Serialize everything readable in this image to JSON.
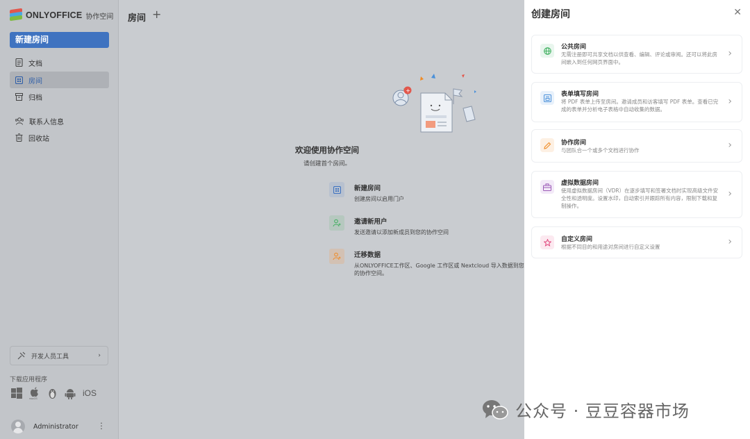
{
  "sidebar": {
    "logo_text": "ONLYOFFICE",
    "logo_sub": "协作空间",
    "new_room_button": "新建房间",
    "nav": [
      {
        "label": "文档",
        "icon": "document-icon"
      },
      {
        "label": "房间",
        "icon": "rooms-icon",
        "active": true
      },
      {
        "label": "归档",
        "icon": "archive-icon"
      },
      {
        "label": "联系人信息",
        "icon": "contacts-icon"
      },
      {
        "label": "回收站",
        "icon": "trash-icon"
      }
    ],
    "dev_tools": "开发人员工具",
    "download_label": "下载应用程序",
    "download_ios": "iOS",
    "user_name": "Administrator"
  },
  "main": {
    "title": "房间",
    "welcome_title": "欢迎使用协作空间",
    "welcome_sub": "请创建首个房间。",
    "actions": [
      {
        "title": "新建房间",
        "desc": "创建房间以启用门户"
      },
      {
        "title": "邀请新用户",
        "desc": "发送邀请以添加新成员到您的协作空间"
      },
      {
        "title": "迁移数据",
        "desc": "从ONLYOFFICE工作区、Google 工作区或 Nextcloud 导入数据到您的协作空间。"
      }
    ]
  },
  "panel": {
    "title": "创建房间",
    "cards": [
      {
        "title": "公共房间",
        "desc": "无需注册即可共享文档以供查看、编辑、评论或审阅。还可以将此房间嵌入到任何网页界面中。",
        "icon": "globe-icon",
        "color": "#3daf5d"
      },
      {
        "title": "表单填写房间",
        "desc": "将 PDF 表单上传至房间。邀请成员和访客填写 PDF 表单。查看已完成的表单并分析电子表格中自动收集的数据。",
        "icon": "form-icon",
        "color": "#4a90d9"
      },
      {
        "title": "协作房间",
        "desc": "与团队合一个或多个文档进行协作",
        "icon": "pencil-icon",
        "color": "#f08a24"
      },
      {
        "title": "虚拟数据房间",
        "desc": "使用虚拟数据房间（VDR）在逐步填写和签署文档时实现高级文件安全性和透明度。设置水印，自动索引并跟踪所有内容，限制下载和复制操作。",
        "icon": "briefcase-icon",
        "color": "#9b59b6"
      },
      {
        "title": "自定义房间",
        "desc": "根据不同目的和用途对房间进行自定义设置",
        "icon": "star-icon",
        "color": "#e0457b"
      }
    ]
  },
  "watermark": "公众号 · 豆豆容器市场"
}
